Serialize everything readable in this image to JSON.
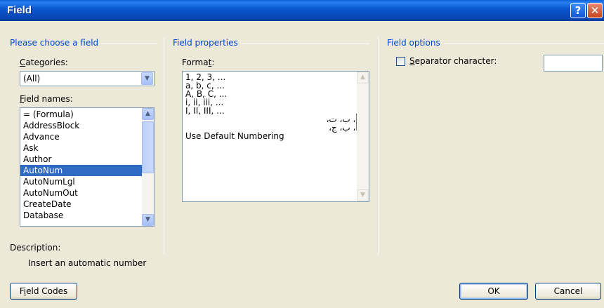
{
  "window": {
    "title": "Field",
    "help_glyph": "?",
    "close_glyph": "✕"
  },
  "field_group": {
    "title": "Please choose a field",
    "categories_label_prefix": "",
    "categories_label_u": "C",
    "categories_label_rest": "ategories:",
    "categories_value": "(All)",
    "field_names_label_u": "F",
    "field_names_label_rest": "ield names:",
    "field_names": [
      "= (Formula)",
      "AddressBlock",
      "Advance",
      "Ask",
      "Author",
      "AutoNum",
      "AutoNumLgl",
      "AutoNumOut",
      "CreateDate",
      "Database"
    ],
    "selected_field": "AutoNum"
  },
  "properties_group": {
    "title": "Field properties",
    "format_label_prefix": "Forma",
    "format_label_u": "t",
    "format_label_rest": ":",
    "formats": [
      "1, 2, 3, ...",
      "a, b, c, ...",
      "A, B, C, ...",
      "i, ii, iii, ...",
      "I, II, III, ...",
      "... أ، ب، ت،",
      "... أ، ب، ج،",
      "Use Default Numbering"
    ]
  },
  "options_group": {
    "title": "Field options",
    "separator_label_u": "S",
    "separator_label_rest": "eparator character:",
    "separator_checked": false,
    "separator_value": ""
  },
  "description": {
    "label": "Description:",
    "text": "Insert an automatic number"
  },
  "buttons": {
    "field_codes_prefix": "F",
    "field_codes_u": "i",
    "field_codes_rest": "eld Codes",
    "ok": "OK",
    "cancel": "Cancel"
  },
  "icons": {
    "dropdown": "chevron-down-icon",
    "scroll_up": "arrow-up-icon",
    "scroll_down": "arrow-down-icon"
  }
}
